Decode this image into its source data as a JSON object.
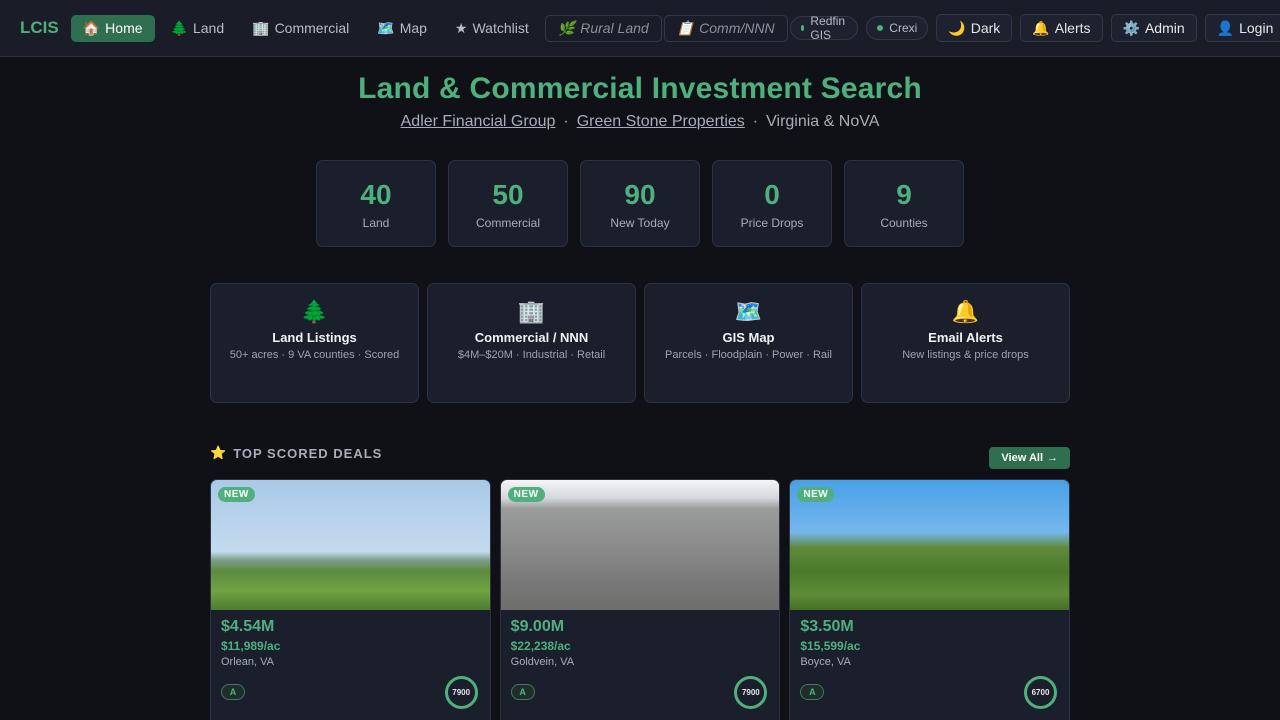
{
  "nav": {
    "brand": "LCIS",
    "links": [
      {
        "icon": "🏠",
        "label": "Home"
      },
      {
        "icon": "🌲",
        "label": "Land"
      },
      {
        "icon": "🏢",
        "label": "Commercial"
      },
      {
        "icon": "🗺️",
        "label": "Map"
      },
      {
        "icon": "★",
        "label": "Watchlist"
      }
    ],
    "outlined": [
      {
        "icon": "🌿",
        "label": "Rural Land"
      },
      {
        "icon": "📋",
        "label": "Comm/NNN"
      }
    ],
    "sources": [
      "Redfin GIS",
      "Crexi"
    ],
    "buttons": [
      {
        "icon": "🌙",
        "label": "Dark"
      },
      {
        "icon": "🔔",
        "label": "Alerts"
      },
      {
        "icon": "⚙️",
        "label": "Admin"
      },
      {
        "icon": "👤",
        "label": "Login"
      }
    ]
  },
  "hero": {
    "title": "Land & Commercial Investment Search",
    "link1": "Adler Financial Group",
    "separator": "·",
    "link2": "Green Stone Properties",
    "region": "Virginia & NoVA"
  },
  "stats": [
    {
      "value": "40",
      "label": "Land"
    },
    {
      "value": "50",
      "label": "Commercial"
    },
    {
      "value": "90",
      "label": "New Today"
    },
    {
      "value": "0",
      "label": "Price Drops"
    },
    {
      "value": "9",
      "label": "Counties"
    }
  ],
  "features": [
    {
      "icon": "🌲",
      "title": "Land Listings",
      "desc": "50+ acres · 9 VA counties · Scored"
    },
    {
      "icon": "🏢",
      "title": "Commercial / NNN",
      "desc": "$4M–$20M · Industrial · Retail"
    },
    {
      "icon": "🗺️",
      "title": "GIS Map",
      "desc": "Parcels · Floodplain · Power · Rail"
    },
    {
      "icon": "🔔",
      "title": "Email Alerts",
      "desc": "New listings & price drops"
    }
  ],
  "section": {
    "icon": "⭐",
    "title": "TOP SCORED DEALS",
    "view_all": "View All",
    "view_all_arrow": "→"
  },
  "deals": [
    {
      "badge": "NEW",
      "price": "$4.54M",
      "ppa": "$11,989/ac",
      "location": "Orlean, VA",
      "grade": "A",
      "score": "7900"
    },
    {
      "badge": "NEW",
      "price": "$9.00M",
      "ppa": "$22,238/ac",
      "location": "Goldvein, VA",
      "grade": "A",
      "score": "7900"
    },
    {
      "badge": "NEW",
      "price": "$3.50M",
      "ppa": "$15,599/ac",
      "location": "Boyce, VA",
      "grade": "A",
      "score": "6700"
    }
  ]
}
